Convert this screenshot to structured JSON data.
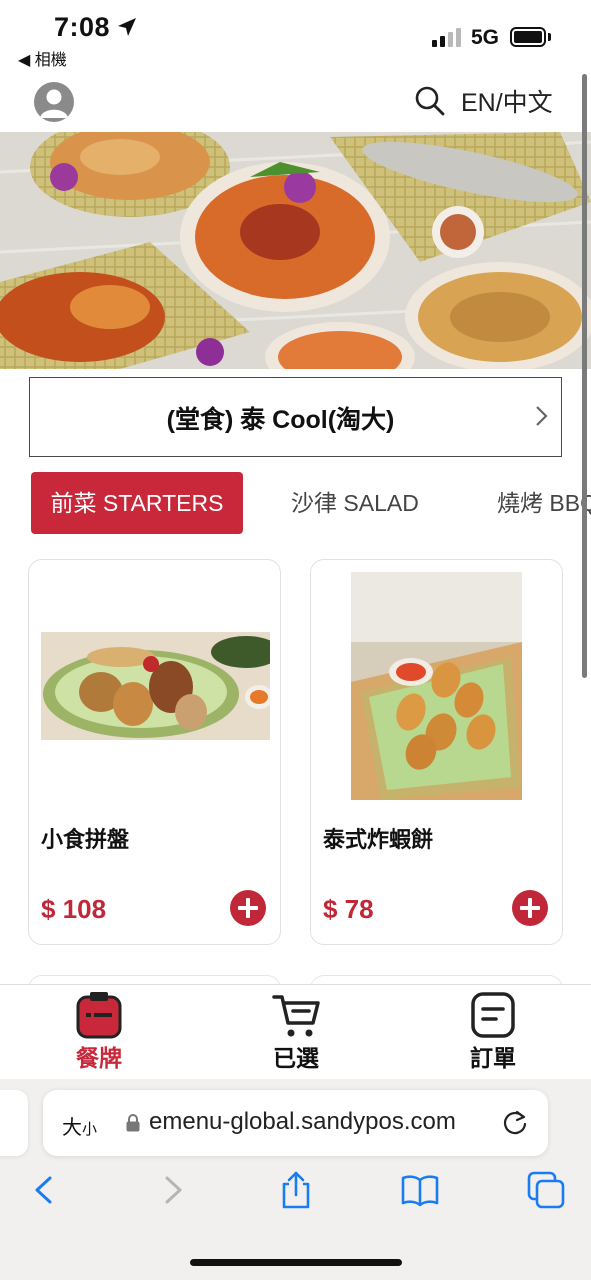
{
  "status_bar": {
    "time": "7:08",
    "back_label": "◀ 相機",
    "network": "5G"
  },
  "header": {
    "language_toggle": "EN/中文"
  },
  "store": {
    "name": "(堂食) 泰 Cool(淘大)"
  },
  "tabs": [
    {
      "label": "前菜 STARTERS",
      "active": true
    },
    {
      "label": "沙律 SALAD",
      "active": false
    },
    {
      "label": "燒烤 BBQ",
      "active": false
    }
  ],
  "products": [
    {
      "name": "小食拼盤",
      "price": "$ 108"
    },
    {
      "name": "泰式炸蝦餅",
      "price": "$ 78"
    }
  ],
  "bottom_nav": [
    {
      "label": "餐牌",
      "active": true,
      "icon": "menu-icon"
    },
    {
      "label": "已選",
      "active": false,
      "icon": "cart-icon"
    },
    {
      "label": "訂單",
      "active": false,
      "icon": "order-icon"
    }
  ],
  "browser": {
    "text_size_label": "大",
    "text_size_small": "小",
    "url": "emenu-global.sandypos.com"
  },
  "colors": {
    "accent": "#c8283a",
    "price": "#c0283a"
  }
}
